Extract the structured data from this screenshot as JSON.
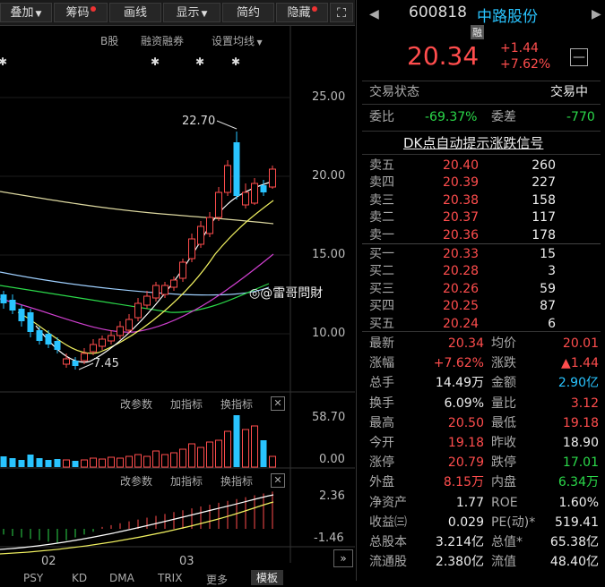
{
  "toolbar": {
    "items": [
      {
        "label": "叠加",
        "dot": false,
        "caret": true
      },
      {
        "label": "筹码",
        "dot": true,
        "caret": false
      },
      {
        "label": "画线",
        "dot": false,
        "caret": false
      },
      {
        "label": "显示",
        "dot": false,
        "caret": true
      },
      {
        "label": "简约",
        "dot": false,
        "caret": false
      },
      {
        "label": "隐藏",
        "dot": true,
        "caret": false
      }
    ],
    "expand_icon": "expand-icon"
  },
  "chart_top_links": [
    "B股",
    "融资融券",
    "设置均线"
  ],
  "price_axis": [
    "25.00",
    "20.00",
    "15.00",
    "10.00"
  ],
  "annotations": {
    "high": "22.70",
    "low": "7.45"
  },
  "watermark": "@雷哥問財",
  "volume_panel": {
    "buttons": [
      "改参数",
      "加指标",
      "换指标"
    ],
    "axis": [
      "58.70",
      "0.00"
    ]
  },
  "macd_panel": {
    "buttons": [
      "改参数",
      "加指标",
      "换指标"
    ],
    "axis": [
      "2.36",
      "-1.46"
    ]
  },
  "date_axis": [
    "02",
    "03"
  ],
  "bottom_tabs": [
    "PSY",
    "KD",
    "DMA",
    "TRIX",
    "更多",
    "模板"
  ],
  "stock": {
    "code": "600818",
    "name": "中路股份",
    "badge": "融",
    "price": "20.34",
    "change": "+1.44",
    "change_pct": "+7.62%"
  },
  "status": {
    "label": "交易状态",
    "value": "交易中"
  },
  "ratio": {
    "wb_label": "委比",
    "wb_value": "-69.37%",
    "wc_label": "委差",
    "wc_value": "-770"
  },
  "signal_title": "DK点自动提示涨跌信号",
  "asks": [
    {
      "label": "卖五",
      "price": "20.40",
      "vol": "260"
    },
    {
      "label": "卖四",
      "price": "20.39",
      "vol": "227"
    },
    {
      "label": "卖三",
      "price": "20.38",
      "vol": "158"
    },
    {
      "label": "卖二",
      "price": "20.37",
      "vol": "117"
    },
    {
      "label": "卖一",
      "price": "20.36",
      "vol": "178"
    }
  ],
  "bids": [
    {
      "label": "买一",
      "price": "20.33",
      "vol": "15"
    },
    {
      "label": "买二",
      "price": "20.28",
      "vol": "3"
    },
    {
      "label": "买三",
      "price": "20.26",
      "vol": "59"
    },
    {
      "label": "买四",
      "price": "20.25",
      "vol": "87"
    },
    {
      "label": "买五",
      "price": "20.24",
      "vol": "6"
    }
  ],
  "stats": [
    {
      "l1": "最新",
      "v1": "20.34",
      "c1": "red",
      "l2": "均价",
      "v2": "20.01",
      "c2": "red"
    },
    {
      "l1": "涨幅",
      "v1": "+7.62%",
      "c1": "red",
      "l2": "涨跌",
      "v2": "▲1.44",
      "c2": "red"
    },
    {
      "l1": "总手",
      "v1": "14.49万",
      "c1": "white",
      "l2": "金额",
      "v2": "2.90亿",
      "c2": "cyan"
    },
    {
      "l1": "换手",
      "v1": "6.09%",
      "c1": "white",
      "l2": "量比",
      "v2": "3.12",
      "c2": "red"
    },
    {
      "l1": "最高",
      "v1": "20.50",
      "c1": "red",
      "l2": "最低",
      "v2": "19.18",
      "c2": "red"
    },
    {
      "l1": "今开",
      "v1": "19.18",
      "c1": "red",
      "l2": "昨收",
      "v2": "18.90",
      "c2": "white"
    },
    {
      "l1": "涨停",
      "v1": "20.79",
      "c1": "red",
      "l2": "跌停",
      "v2": "17.01",
      "c2": "green"
    },
    {
      "l1": "外盘",
      "v1": "8.15万",
      "c1": "red",
      "l2": "内盘",
      "v2": "6.34万",
      "c2": "green"
    },
    {
      "l1": "净资产",
      "v1": "1.77",
      "c1": "white",
      "l2": "ROE",
      "v2": "1.60%",
      "c2": "white"
    },
    {
      "l1": "收益㈢",
      "v1": "0.029",
      "c1": "white",
      "l2": "PE(动)*",
      "v2": "519.41",
      "c2": "white"
    },
    {
      "l1": "总股本",
      "v1": "3.214亿",
      "c1": "white",
      "l2": "总值*",
      "v2": "65.38亿",
      "c2": "white"
    },
    {
      "l1": "流通股",
      "v1": "2.380亿",
      "c1": "white",
      "l2": "流值",
      "v2": "48.40亿",
      "c2": "white"
    }
  ],
  "colors": {
    "up": "#ff4d4d",
    "down": "#29c4ff",
    "green": "#2bd94a"
  }
}
